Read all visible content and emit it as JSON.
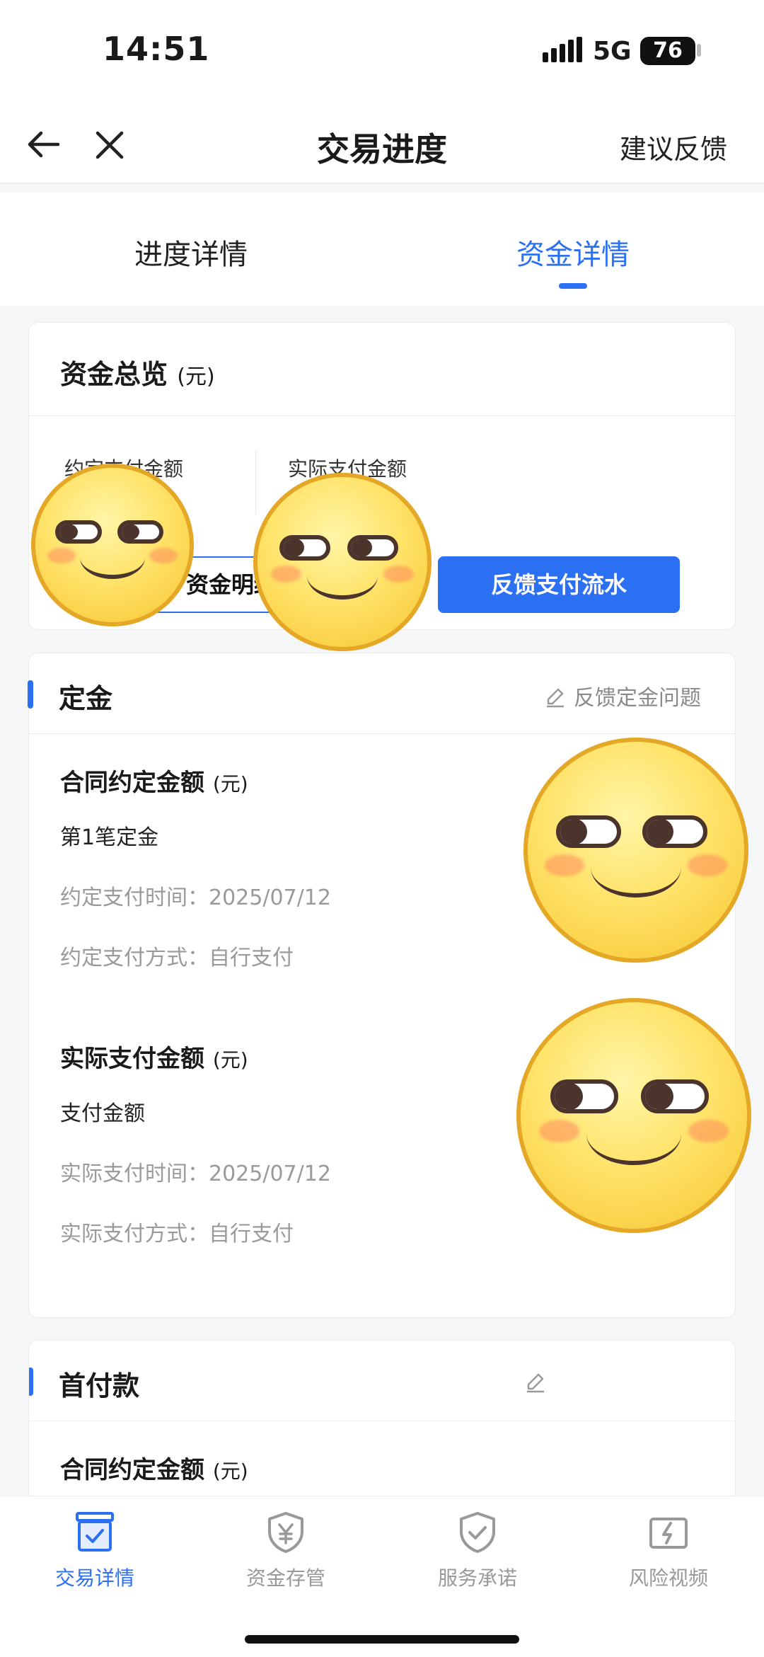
{
  "status_bar": {
    "time": "14:51",
    "network": "5G",
    "battery": "76"
  },
  "nav": {
    "title": "交易进度",
    "feedback": "建议反馈"
  },
  "tabs": [
    {
      "label": "进度详情"
    },
    {
      "label": "资金详情"
    }
  ],
  "overview": {
    "title": "资金总览",
    "unit": "(元)",
    "col1": "约定支付金额",
    "col2": "实际支付金额",
    "btn_detail": "资金明细",
    "btn_feedback": "反馈支付流水"
  },
  "deposit": {
    "label": "定金",
    "issue": "反馈定金问题",
    "contract_title": "合同约定金额",
    "unit": "(元)",
    "item": "第1笔定金",
    "agreed_time": "约定支付时间：2025/07/12",
    "agreed_method": "约定支付方式：自行支付",
    "actual_title": "实际支付金额",
    "actual_item": "支付金额",
    "actual_time": "实际支付时间：2025/07/12",
    "actual_method": "实际支付方式：自行支付"
  },
  "downpayment": {
    "label": "首付款",
    "contract_title": "合同约定金额",
    "unit": "(元)"
  },
  "bottom_tabs": [
    {
      "label": "交易详情",
      "icon": "box-check-icon"
    },
    {
      "label": "资金存管",
      "icon": "shield-yen-icon"
    },
    {
      "label": "服务承诺",
      "icon": "shield-check-icon"
    },
    {
      "label": "风险视频",
      "icon": "video-icon"
    }
  ],
  "colors": {
    "accent": "#2b6ff2"
  }
}
